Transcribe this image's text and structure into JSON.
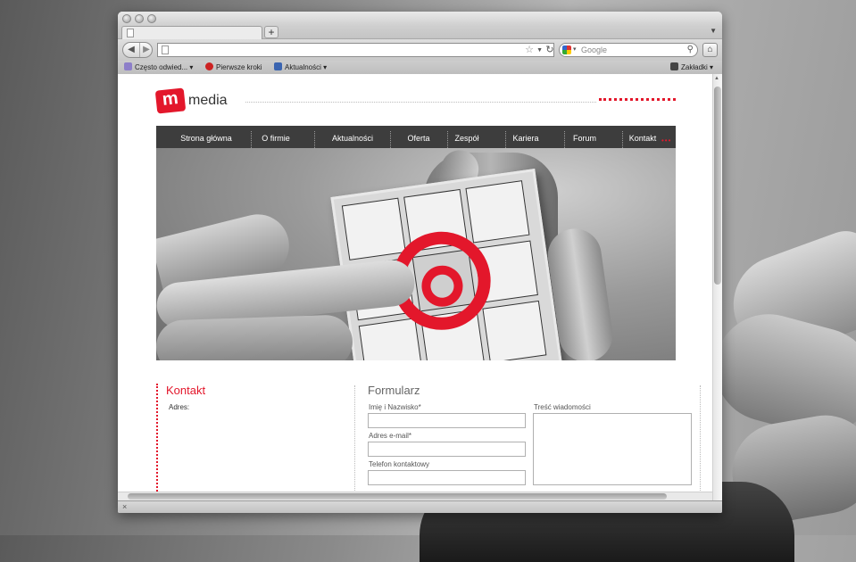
{
  "browser": {
    "new_tab": "+",
    "search_placeholder": "Google",
    "bookmarks": [
      {
        "label": "Często odwied...",
        "icon": "folder-icon"
      },
      {
        "label": "Pierwsze kroki",
        "icon": "firefox-icon"
      },
      {
        "label": "Aktualności",
        "icon": "rss-icon"
      }
    ],
    "bookmarks_menu": "Zakładki",
    "status_close": "×"
  },
  "site": {
    "logo_letter": "m",
    "logo_text": "media",
    "menu": [
      "Strona główna",
      "O firmie",
      "Aktualności",
      "Oferta",
      "Zespół",
      "Kariera",
      "Forum",
      "Kontakt"
    ],
    "menu_dots": "•••",
    "contact": {
      "title": "Kontakt",
      "address_label": "Adres:"
    },
    "form": {
      "title": "Formularz",
      "name_label": "Imię i Nazwisko*",
      "email_label": "Adres e-mail*",
      "phone_label": "Telefon kontaktowy",
      "message_label": "Treść wiadomości"
    }
  },
  "colors": {
    "brand_red": "#e3172b",
    "menu_bg": "#3d3d3d"
  }
}
